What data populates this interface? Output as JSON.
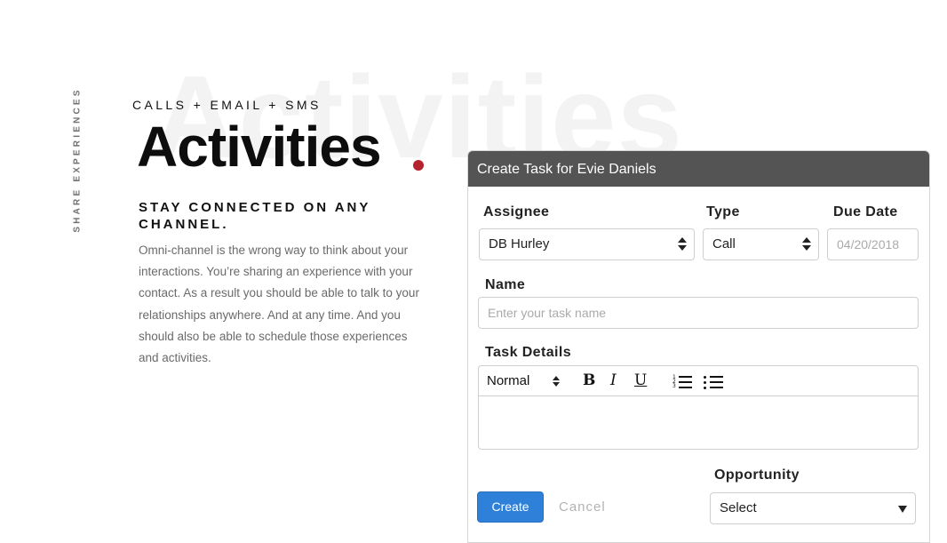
{
  "side_label": "SHARE EXPERIENCES",
  "hero": {
    "watermark": "Activities",
    "eyebrow": "CALLS + EMAIL + SMS",
    "title": "Activities",
    "accent_color": "#b5232f",
    "subhead": "STAY CONNECTED ON ANY CHANNEL.",
    "body": "Omni-channel is the wrong way to think about your interactions. You’re sharing an experience with your contact. As a result you should be able to talk to your relationships anywhere. And at any time. And you should also be able to schedule those experiences and activities."
  },
  "form": {
    "header": "Create Task for Evie Daniels",
    "assignee": {
      "label": "Assignee",
      "value": "DB Hurley"
    },
    "type": {
      "label": "Type",
      "value": "Call"
    },
    "due_date": {
      "label": "Due Date",
      "placeholder": "04/20/2018"
    },
    "name": {
      "label": "Name",
      "placeholder": "Enter your task name"
    },
    "task_details": {
      "label": "Task Details",
      "toolbar": {
        "style_value": "Normal",
        "bold": "B",
        "italic": "I",
        "underline": "U"
      }
    },
    "opportunity": {
      "label": "Opportunity",
      "value": "Select"
    },
    "create_label": "Create",
    "cancel_label": "Cancel"
  }
}
